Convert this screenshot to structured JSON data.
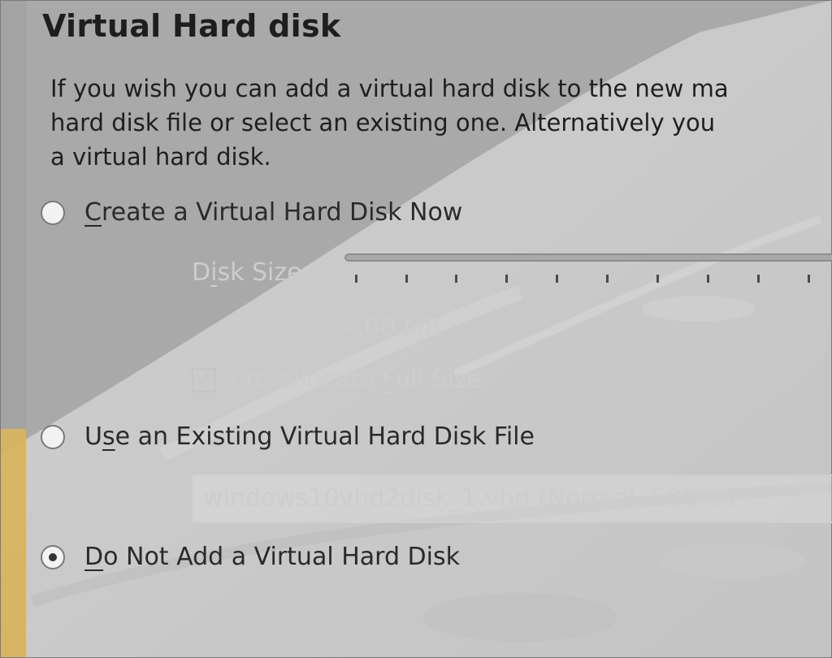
{
  "dialog": {
    "heading": "Virtual Hard disk",
    "description_lines": [
      "If you wish you can add a virtual hard disk to the new ma",
      "hard disk file or select an existing one. Alternatively you",
      "a virtual hard disk."
    ]
  },
  "options": {
    "create": {
      "mnemonic": "C",
      "rest": "reate a Virtual Hard Disk Now",
      "checked": false
    },
    "existing": {
      "pre": "U",
      "mnemonic": "s",
      "rest": "e an Existing Virtual Hard Disk File",
      "checked": false
    },
    "none": {
      "mnemonic": "D",
      "rest": "o Not Add a Virtual Hard Disk",
      "checked": true
    }
  },
  "disk_size": {
    "label_pre": "D",
    "label_mnemonic": "i",
    "label_rest": "sk Size:",
    "value": "4.00 MB"
  },
  "preallocate": {
    "label_pre": "Pre-allocate ",
    "label_mnemonic": "F",
    "label_rest": "ull Size",
    "checked": true,
    "check_glyph": "✓"
  },
  "existing_file": {
    "value": "windows10vhd2disk_1.vhd (Normal, 500.00"
  },
  "colors": {
    "accent_strip": "#d9b559",
    "disabled_text": "#cdcdcd"
  }
}
